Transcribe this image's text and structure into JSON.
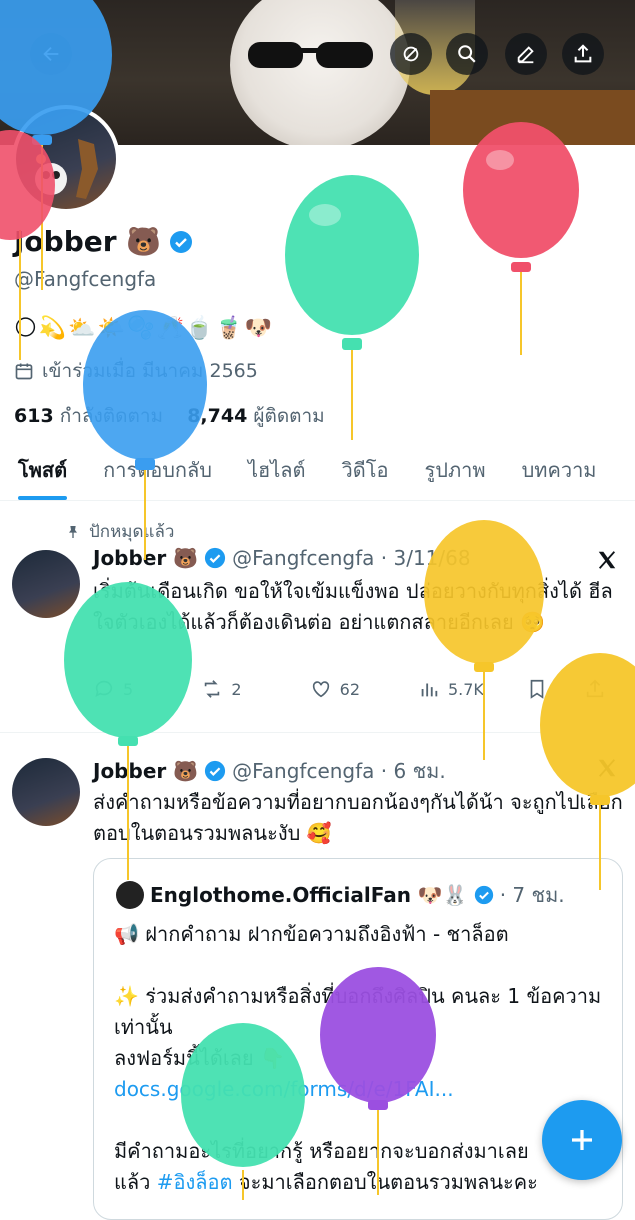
{
  "profile": {
    "name": "Jobber 🐻",
    "handle": "@Fangfcengfa",
    "bio": "🌕💫⛅🌤️🫧🥂🍵🧋🐶",
    "joined": "เข้าร่วมเมื่อ มีนาคม 2565",
    "following_count": "613",
    "following_label": "กำลังติดตาม",
    "followers_count": "8,744",
    "followers_label": "ผู้ติดตาม"
  },
  "header": {
    "icons": [
      "back-icon",
      "cancel-sync-icon",
      "search-icon",
      "edit-icon",
      "share-icon"
    ]
  },
  "tabs": [
    {
      "label": "โพสต์",
      "active": true
    },
    {
      "label": "การตอบกลับ",
      "active": false
    },
    {
      "label": "ไฮไลต์",
      "active": false
    },
    {
      "label": "วิดีโอ",
      "active": false
    },
    {
      "label": "รูปภาพ",
      "active": false
    },
    {
      "label": "บทความ",
      "active": false
    }
  ],
  "pinned": {
    "label": "ปักหมุดแล้ว",
    "name": "Jobber 🐻",
    "meta": "@Fangfcengfa · 3/11/68",
    "text": "เริ่มต้นเดือนเกิด ขอให้ใจเข้มแข็งพอ ปล่อยวางกับทุกสิ่งได้ ฮีลใจตัวเองได้แล้วก็ต้องเดินต่อ อย่าแตกสลายอีกเลย 🥺",
    "replies": "5",
    "reposts": "2",
    "likes": "62",
    "views": "5.7K"
  },
  "tweet2": {
    "name": "Jobber 🐻",
    "meta": "@Fangfcengfa · 6 ชม.",
    "text": "ส่งคำถามหรือข้อความที่อยากบอกน้องๆกันได้น้า จะถูกไปเลือกตอบในตอนรวมพลนะงับ 🥰",
    "quote": {
      "name": "Englothome.OfficialFan 🐶🐰",
      "meta": "· 7 ชม.",
      "line1": "📢 ฝากคำถาม ฝากข้อความถึงอิงฟ้า - ชาล็อต",
      "line2": "✨ ร่วมส่งคำถามหรือสิ่งที่บอกถึงศิลปิน คนละ 1 ข้อความเท่านั้น",
      "line3": "ลงฟอร์มนี้ได้เลย 👇",
      "link": "docs.google.com/forms/d/e/1FAI...",
      "line4a": "มีคำถามอะไรที่อยากรู้ หรืออยากจะบอกส่งมาเลย",
      "line4b": "แล้ว ",
      "hashtag": "#อิงล็อต",
      "line4c": " จะมาเลือกตอบในตอนรวมพลนะคะ"
    }
  },
  "colors": {
    "accent": "#1d9bf0",
    "balloons": [
      "#3a9df0",
      "#f0506a",
      "#45e0b0",
      "#3a9df0",
      "#45e0b0",
      "#f6c62a",
      "#f6c62a",
      "#9b4fe0",
      "#45e0b0"
    ]
  }
}
